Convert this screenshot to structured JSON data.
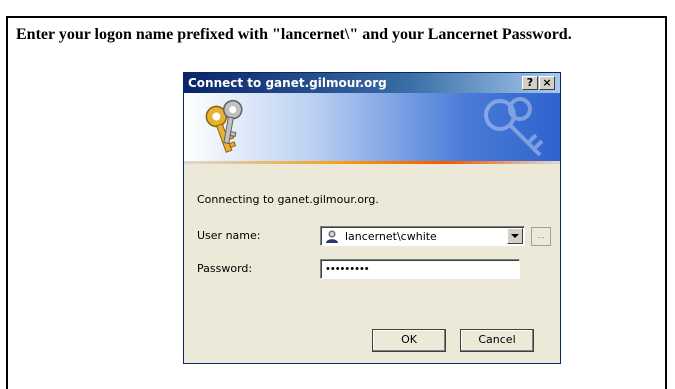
{
  "instruction": "Enter your logon name prefixed with \"lancernet\\\" and your Lancernet Password.",
  "dialog": {
    "title": "Connect to ganet.gilmour.org",
    "help_label": "?",
    "close_label": "×",
    "connecting_text": "Connecting to ganet.gilmour.org.",
    "username_label": "User name:",
    "username_value": "lancernet\\cwhite",
    "browse_label": "...",
    "password_label": "Password:",
    "password_value": "•••••••••",
    "ok_label": "OK",
    "cancel_label": "Cancel"
  },
  "icons": {
    "banner": "keys-icon",
    "user": "user-icon",
    "dropdown": "chevron-down-icon"
  }
}
